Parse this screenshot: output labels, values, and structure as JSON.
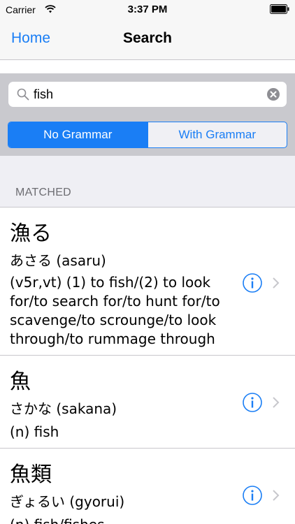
{
  "status_bar": {
    "carrier": "Carrier",
    "time": "3:37 PM"
  },
  "nav": {
    "back_label": "Home",
    "title": "Search"
  },
  "search": {
    "value": "fish",
    "placeholder": ""
  },
  "segments": {
    "no_grammar": "No Grammar",
    "with_grammar": "With Grammar",
    "selected": "No Grammar"
  },
  "section": {
    "header": "MATCHED"
  },
  "results": [
    {
      "kanji": "漁る",
      "reading": "あさる (asaru)",
      "meaning": "(v5r,vt) (1) to fish/(2) to look for/to search for/to hunt for/to scavenge/to scrounge/to look through/to rummage through"
    },
    {
      "kanji": "魚",
      "reading": "さかな (sakana)",
      "meaning": "(n) fish"
    },
    {
      "kanji": "魚類",
      "reading": "ぎょるい (gyorui)",
      "meaning": "(n) fish/fishes"
    }
  ],
  "colors": {
    "accent": "#1a7ef5",
    "panel": "#c9c9ce",
    "section_bg": "#efeff4"
  }
}
